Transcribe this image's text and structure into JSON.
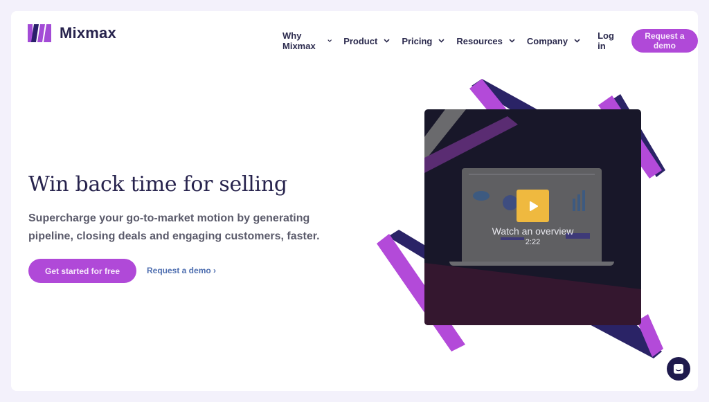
{
  "brand": {
    "name": "Mixmax",
    "icon": "mixmax-logo-icon",
    "colors": {
      "primary": "#b049d8",
      "navy": "#27234d",
      "link": "#4f6fb0",
      "play": "#efb93f",
      "background": "#f3f1fb"
    }
  },
  "nav": {
    "items": [
      {
        "label": "Why Mixmax",
        "icon": "chevron-down-icon"
      },
      {
        "label": "Product",
        "icon": "chevron-down-icon"
      },
      {
        "label": "Pricing",
        "icon": "chevron-down-icon"
      },
      {
        "label": "Resources",
        "icon": "chevron-down-icon"
      },
      {
        "label": "Company",
        "icon": "chevron-down-icon"
      }
    ],
    "login_label": "Log in",
    "cta_label": "Request a demo"
  },
  "hero": {
    "title": "Win back time for selling",
    "subtitle": "Supercharge your go-to-market motion by generating pipeline, closing deals and engaging customers, faster.",
    "primary_cta": "Get started for free",
    "secondary_cta": "Request a demo ›"
  },
  "video": {
    "label": "Watch an overview",
    "duration": "2:22",
    "icon": "play-icon"
  },
  "chat": {
    "icon": "chat-icon"
  }
}
